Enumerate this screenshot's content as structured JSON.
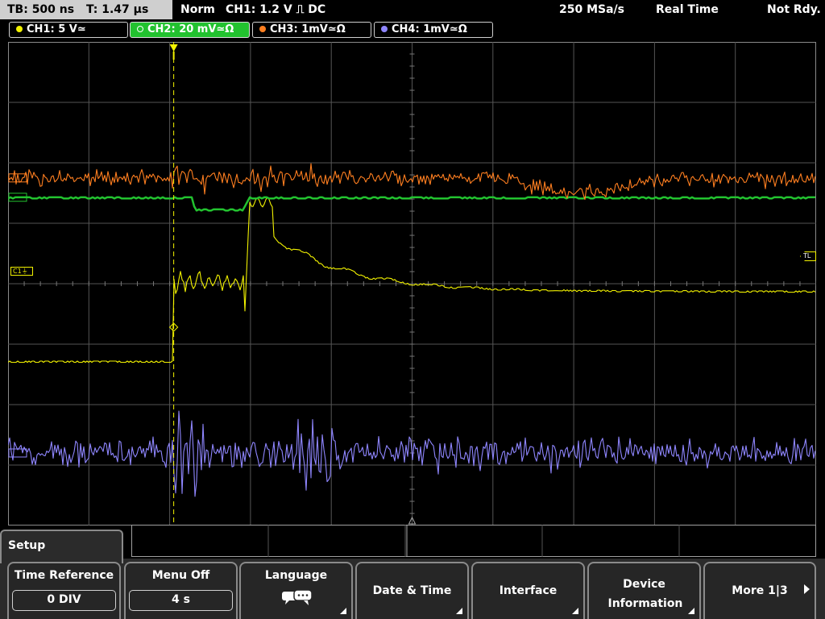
{
  "status": {
    "timebase": "TB: 500 ns",
    "trigger_time": "T: 1.47 µs",
    "acq_mode": "Norm",
    "trigger_info": "CH1: 1.2 V ⎍ DC",
    "sample_rate": "250 MSa/s",
    "real_time": "Real Time",
    "ready_state": "Not Rdy."
  },
  "channels": [
    {
      "label": "CH1: 5 V≃",
      "color": "#f2f200",
      "active": false
    },
    {
      "label": "CH2: 20 mV≃Ω",
      "color": "#22c22f",
      "active": true
    },
    {
      "label": "CH3: 1mV≃Ω",
      "color": "#ff7f20",
      "active": false
    },
    {
      "label": "CH4: 1mV≃Ω",
      "color": "#8f86ff",
      "active": false
    }
  ],
  "markers": {
    "ch1": "C1",
    "trigger_level": "TL"
  },
  "chart_data": {
    "type": "line",
    "grid": true,
    "grid_divisions": {
      "x": 10,
      "y": 8
    },
    "trigger_position": "x = 2.05 div",
    "traces": [
      {
        "name": "CH1",
        "color": "#f2f200",
        "kind": "step",
        "pre_level_div": 2.72,
        "post_level_div": 3.88
      },
      {
        "name": "CH2",
        "color": "#22c22f",
        "kind": "dip",
        "baseline_div": 5.43,
        "dip_div": 5.23
      },
      {
        "name": "CH3",
        "color": "#ff7f20",
        "kind": "noise",
        "baseline_div": 5.75
      },
      {
        "name": "CH4",
        "color": "#8f86ff",
        "kind": "burst",
        "baseline_div": 1.2
      }
    ]
  },
  "menu": {
    "title": "Setup",
    "buttons": [
      {
        "label": "Time Reference",
        "value": "0 DIV"
      },
      {
        "label": "Menu Off",
        "value": "4 s"
      },
      {
        "label": "Language"
      },
      {
        "label": "Date & Time"
      },
      {
        "label": "Interface"
      },
      {
        "label": "Device Information"
      },
      {
        "label": "More 1|3"
      }
    ]
  }
}
